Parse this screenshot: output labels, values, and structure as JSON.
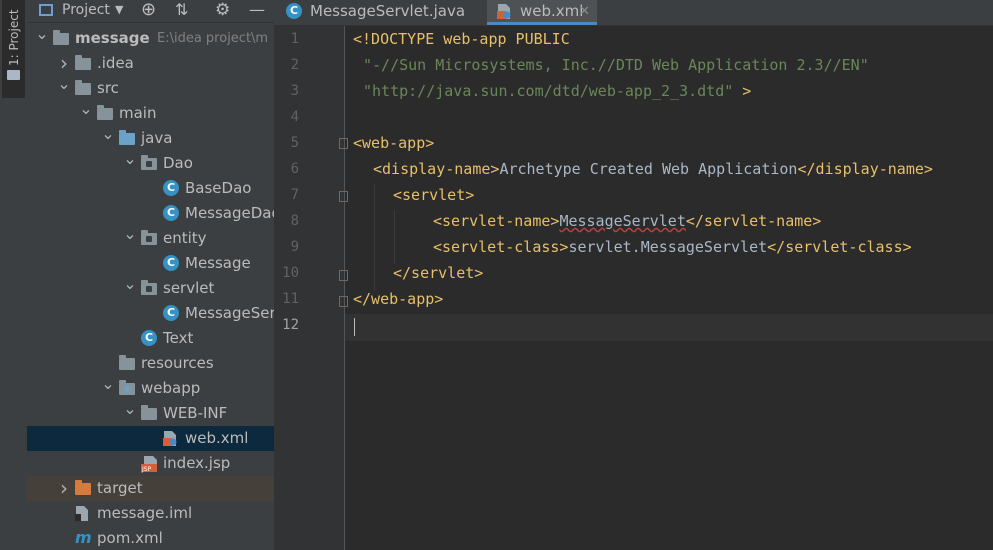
{
  "side_tab": {
    "label": "1: Project"
  },
  "project_header": {
    "title": "Project"
  },
  "tree": [
    {
      "depth": 0,
      "arrow": "down",
      "icon": "module-folder-icon",
      "label": "message",
      "sub": "E:\\idea project\\m"
    },
    {
      "depth": 1,
      "arrow": "right",
      "icon": "folder-icon",
      "label": ".idea"
    },
    {
      "depth": 1,
      "arrow": "down",
      "icon": "folder-icon",
      "label": "src"
    },
    {
      "depth": 2,
      "arrow": "down",
      "icon": "folder-icon",
      "label": "main"
    },
    {
      "depth": 3,
      "arrow": "down",
      "icon": "source-folder-icon",
      "label": "java"
    },
    {
      "depth": 4,
      "arrow": "down",
      "icon": "package-icon",
      "label": "Dao"
    },
    {
      "depth": 5,
      "arrow": "none",
      "icon": "class-icon",
      "label": "BaseDao"
    },
    {
      "depth": 5,
      "arrow": "none",
      "icon": "class-icon",
      "label": "MessageDao"
    },
    {
      "depth": 4,
      "arrow": "down",
      "icon": "package-icon",
      "label": "entity"
    },
    {
      "depth": 5,
      "arrow": "none",
      "icon": "class-icon",
      "label": "Message"
    },
    {
      "depth": 4,
      "arrow": "down",
      "icon": "package-icon",
      "label": "servlet"
    },
    {
      "depth": 5,
      "arrow": "none",
      "icon": "class-icon",
      "label": "MessageServlet"
    },
    {
      "depth": 4,
      "arrow": "none",
      "icon": "class-icon",
      "label": "Text"
    },
    {
      "depth": 3,
      "arrow": "none",
      "icon": "resources-folder-icon",
      "label": "resources"
    },
    {
      "depth": 3,
      "arrow": "down",
      "icon": "web-folder-icon",
      "label": "webapp"
    },
    {
      "depth": 4,
      "arrow": "down",
      "icon": "folder-icon",
      "label": "WEB-INF"
    },
    {
      "depth": 5,
      "arrow": "none",
      "icon": "xml-file-icon",
      "label": "web.xml",
      "selected": true
    },
    {
      "depth": 4,
      "arrow": "none",
      "icon": "jsp-file-icon",
      "label": "index.jsp"
    },
    {
      "depth": 1,
      "arrow": "right",
      "icon": "excluded-folder-icon",
      "label": "target",
      "muted": true
    },
    {
      "depth": 1,
      "arrow": "none",
      "icon": "iml-file-icon",
      "label": "message.iml"
    },
    {
      "depth": 1,
      "arrow": "none",
      "icon": "maven-file-icon",
      "label": "pom.xml"
    }
  ],
  "tabs": [
    {
      "label": "MessageServlet.java",
      "active": false
    },
    {
      "label": "web.xml",
      "active": true
    }
  ],
  "line_numbers": [
    "1",
    "2",
    "3",
    "4",
    "5",
    "6",
    "7",
    "8",
    "9",
    "10",
    "11",
    "12"
  ],
  "code": {
    "l1": {
      "a": "<!DOCTYPE web-app PUBLIC"
    },
    "l2": {
      "a": "\"-//Sun Microsystems, Inc.//DTD Web Application 2.3//EN\""
    },
    "l3": {
      "a": "\"http://java.sun.com/dtd/web-app_2_3.dtd\"",
      "b": " >"
    },
    "l5": {
      "a": "<web-app>"
    },
    "l6": {
      "a": "<display-name>",
      "b": "Archetype Created Web Application",
      "c": "</display-name>"
    },
    "l7": {
      "a": "<servlet>"
    },
    "l8": {
      "a": "<servlet-name>",
      "b": "MessageServlet",
      "c": "</servlet-name>"
    },
    "l9": {
      "a": "<servlet-class>",
      "b": "servlet.MessageServlet",
      "c": "</servlet-class>"
    },
    "l10": {
      "a": "</servlet>"
    },
    "l11": {
      "a": "</web-app>"
    }
  }
}
